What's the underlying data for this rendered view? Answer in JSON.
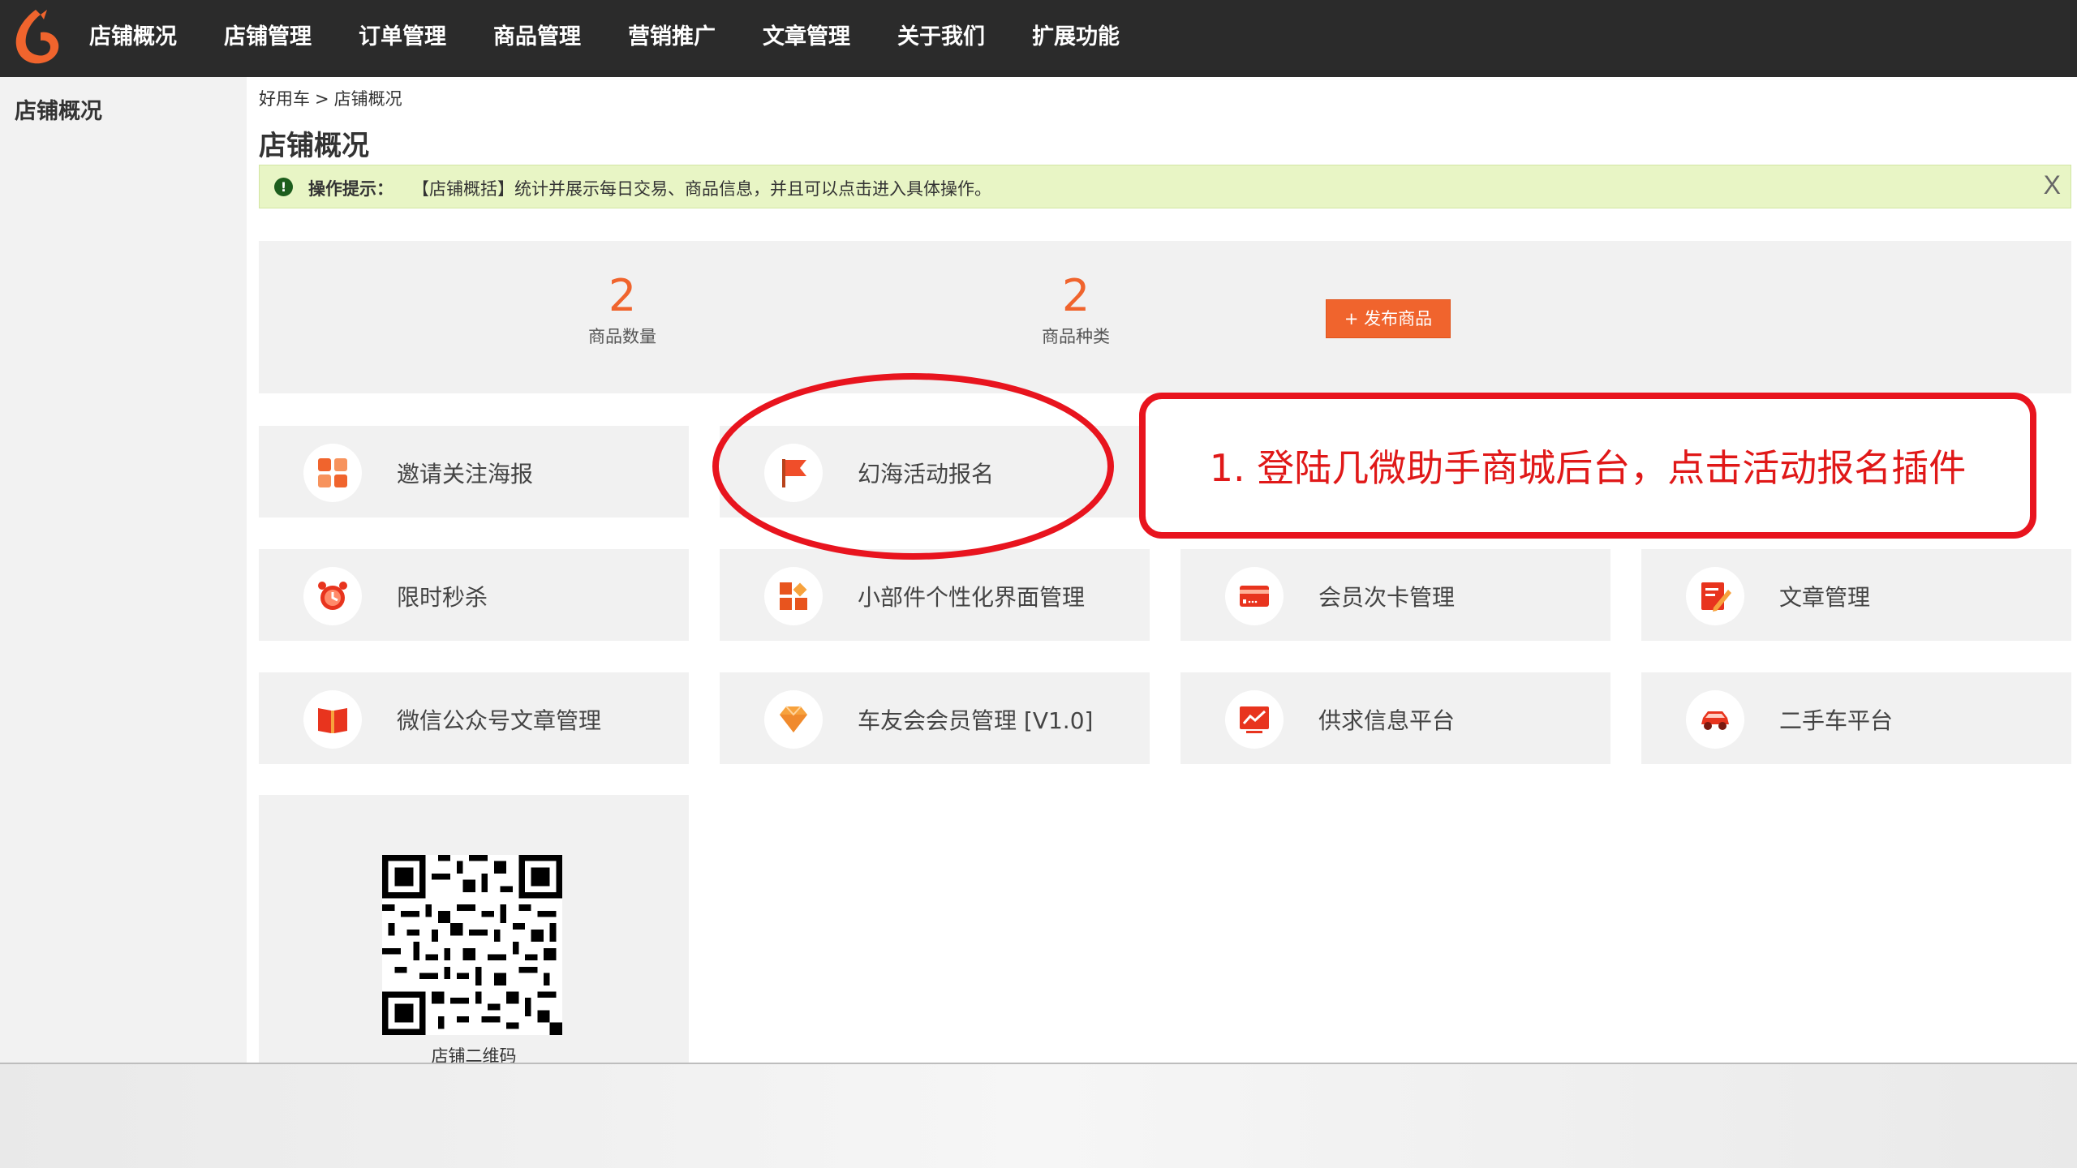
{
  "nav": {
    "items": [
      "店铺概况",
      "店铺管理",
      "订单管理",
      "商品管理",
      "营销推广",
      "文章管理",
      "关于我们",
      "扩展功能"
    ]
  },
  "sidebar": {
    "items": [
      {
        "label": "店铺概况"
      }
    ]
  },
  "breadcrumb": {
    "root": "好用车",
    "separator": ">",
    "current": "店铺概况"
  },
  "page": {
    "title": "店铺概况"
  },
  "tip": {
    "label": "操作提示：",
    "text": "【店铺概括】统计并展示每日交易、商品信息，并且可以点击进入具体操作。",
    "close": "X"
  },
  "stats": {
    "product_count": {
      "value": "2",
      "label": "商品数量"
    },
    "product_types": {
      "value": "2",
      "label": "商品种类"
    },
    "publish_button": "+ 发布商品"
  },
  "tiles": [
    {
      "label": "邀请关注海报",
      "icon": "poster-grid-icon"
    },
    {
      "label": "幻海活动报名",
      "icon": "flag-icon"
    },
    {
      "label": "限时秒杀",
      "icon": "alarm-clock-icon"
    },
    {
      "label": "小部件个性化界面管理",
      "icon": "widget-blocks-icon"
    },
    {
      "label": "会员次卡管理",
      "icon": "member-card-icon"
    },
    {
      "label": "文章管理",
      "icon": "edit-article-icon"
    },
    {
      "label": "微信公众号文章管理",
      "icon": "open-book-icon"
    },
    {
      "label": "车友会会员管理 [V1.0]",
      "icon": "diamond-icon"
    },
    {
      "label": "供求信息平台",
      "icon": "trend-chart-icon"
    },
    {
      "label": "二手车平台",
      "icon": "car-icon"
    }
  ],
  "qr": {
    "label": "店铺二维码"
  },
  "annotation": {
    "text": "1. 登陆几微助手商城后台，点击活动报名插件"
  },
  "colors": {
    "accent": "#f0642d",
    "annotation": "#e8141e",
    "topbar": "#2b2b2b",
    "tip_bg": "#e8f5c5"
  }
}
